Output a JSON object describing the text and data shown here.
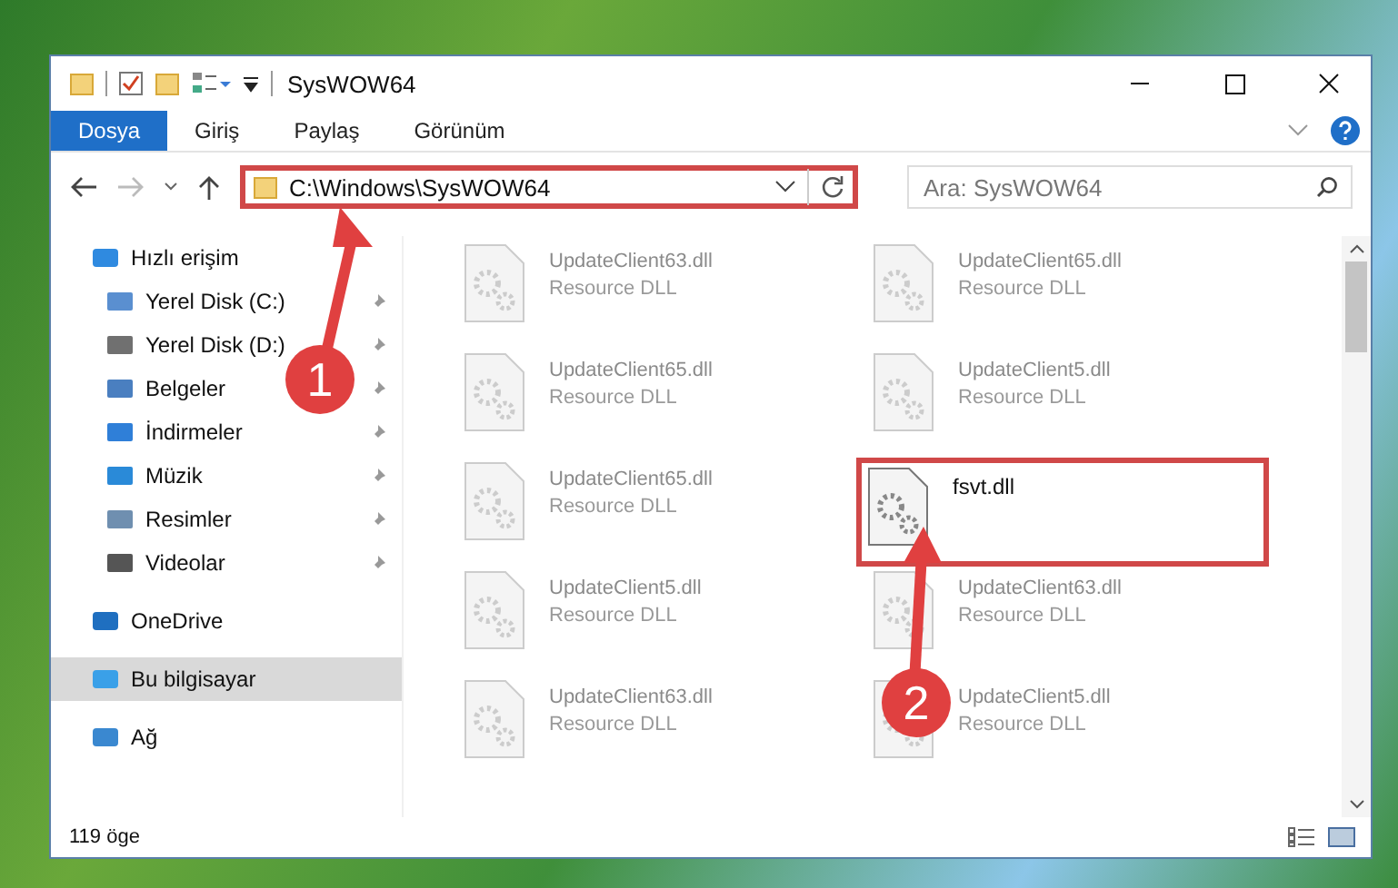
{
  "window": {
    "title": "SysWOW64"
  },
  "ribbon_tabs": [
    {
      "label": "Dosya",
      "selected": true
    },
    {
      "label": "Giriş",
      "selected": false
    },
    {
      "label": "Paylaş",
      "selected": false
    },
    {
      "label": "Görünüm",
      "selected": false
    }
  ],
  "address": {
    "value": "C:\\Windows\\SysWOW64",
    "highlighted": true
  },
  "search": {
    "placeholder": "Ara: SysWOW64"
  },
  "sidebar": {
    "items": [
      {
        "label": "Hızlı erişim",
        "selected": false,
        "children": [
          {
            "label": "Yerel Disk (C:)",
            "pinned": true
          },
          {
            "label": "Yerel Disk (D:)",
            "pinned": true
          },
          {
            "label": "Belgeler",
            "pinned": true
          },
          {
            "label": "İndirmeler",
            "pinned": true
          },
          {
            "label": "Müzik",
            "pinned": true
          },
          {
            "label": "Resimler",
            "pinned": true
          },
          {
            "label": "Videolar",
            "pinned": true
          }
        ]
      },
      {
        "label": "OneDrive",
        "selected": false
      },
      {
        "label": "Bu bilgisayar",
        "selected": true
      },
      {
        "label": "Ağ",
        "selected": false
      }
    ]
  },
  "files": [
    {
      "name": "UpdateClient63.dll",
      "type": "Resource DLL",
      "kind": "blurred"
    },
    {
      "name": "UpdateClient65.dll",
      "type": "Resource DLL",
      "kind": "blurred"
    },
    {
      "name": "UpdateClient65.dll",
      "type": "Resource DLL",
      "kind": "blurred"
    },
    {
      "name": "UpdateClient5.dll",
      "type": "Resource DLL",
      "kind": "blurred"
    },
    {
      "name": "UpdateClient65.dll",
      "type": "Resource DLL",
      "kind": "blurred"
    },
    {
      "name": "fsvt.dll",
      "kind": "highlighted"
    },
    {
      "name": "UpdateClient5.dll",
      "type": "Resource DLL",
      "kind": "blurred"
    },
    {
      "name": "UpdateClient63.dll",
      "type": "Resource DLL",
      "kind": "blurred"
    },
    {
      "name": "UpdateClient63.dll",
      "type": "Resource DLL",
      "kind": "blurred"
    },
    {
      "name": "UpdateClient5.dll",
      "type": "Resource DLL",
      "kind": "blurred"
    }
  ],
  "status_bar": {
    "count": "119 öge"
  },
  "annotations": [
    "1",
    "2"
  ]
}
